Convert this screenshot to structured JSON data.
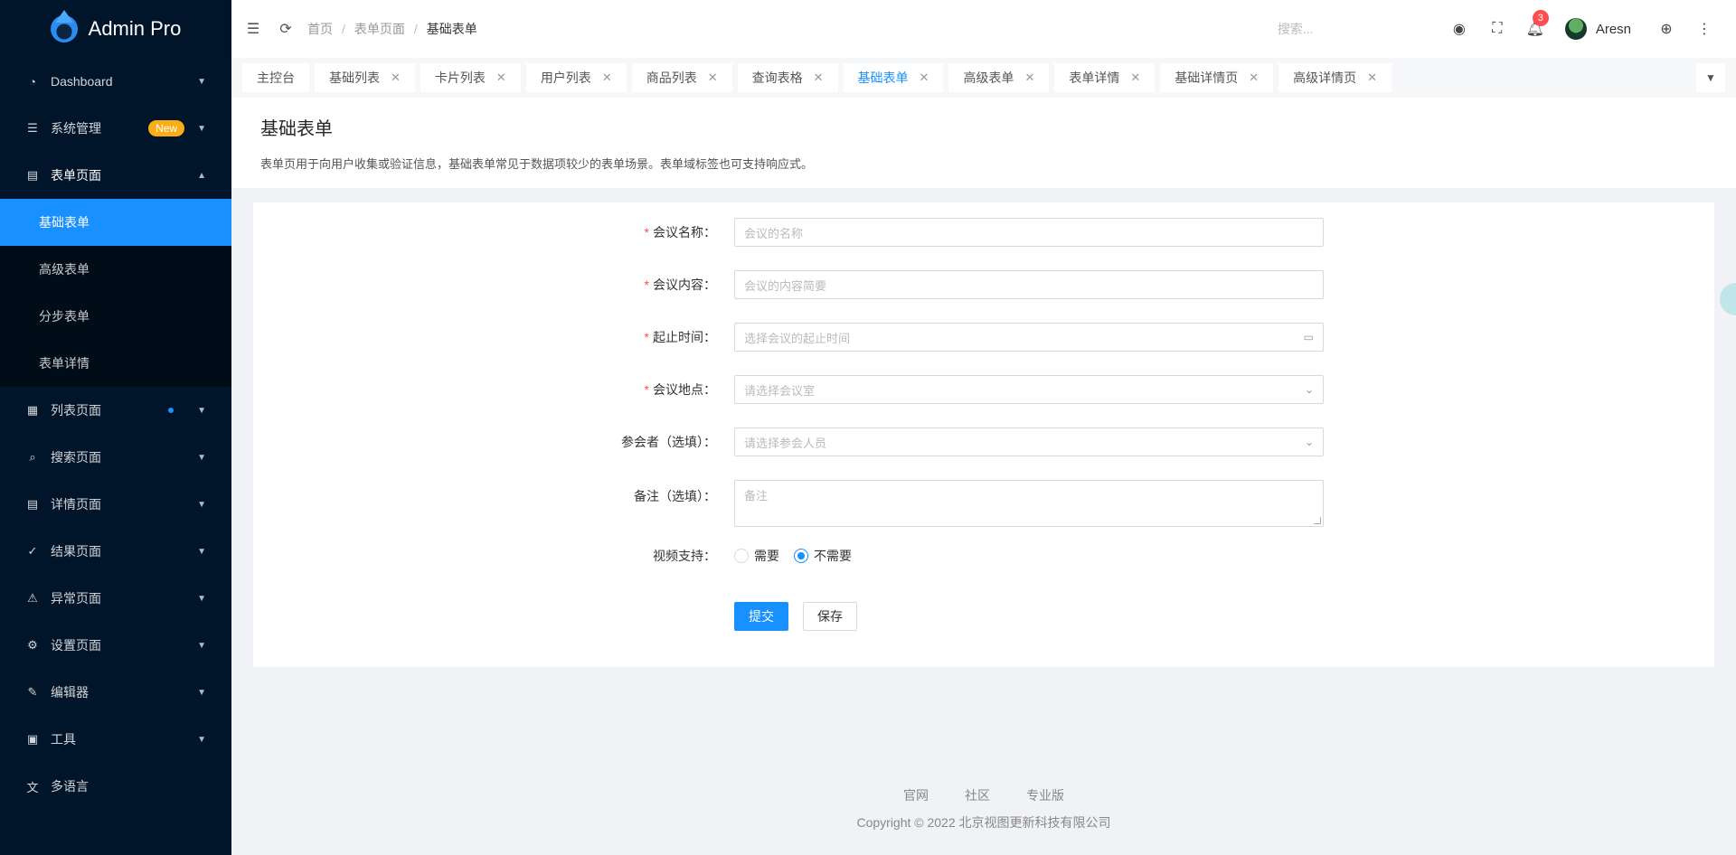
{
  "app": {
    "title": "Admin Pro"
  },
  "sidebar": {
    "items": [
      {
        "label": "Dashboard",
        "icon": "dashboard-icon"
      },
      {
        "label": "系统管理",
        "icon": "settings-sliders-icon",
        "badge": "New"
      },
      {
        "label": "表单页面",
        "icon": "form-icon",
        "open": true,
        "children": [
          "基础表单",
          "高级表单",
          "分步表单",
          "表单详情"
        ]
      },
      {
        "label": "列表页面",
        "icon": "table-icon"
      },
      {
        "label": "搜索页面",
        "icon": "search-icon"
      },
      {
        "label": "详情页面",
        "icon": "profile-icon"
      },
      {
        "label": "结果页面",
        "icon": "check-circle-icon"
      },
      {
        "label": "异常页面",
        "icon": "warning-icon"
      },
      {
        "label": "设置页面",
        "icon": "control-icon"
      },
      {
        "label": "编辑器",
        "icon": "edit-icon"
      },
      {
        "label": "工具",
        "icon": "tool-icon"
      },
      {
        "label": "多语言",
        "icon": "translate-icon"
      }
    ]
  },
  "header": {
    "breadcrumb": [
      "首页",
      "表单页面",
      "基础表单"
    ],
    "search_placeholder": "搜索...",
    "notification_count": "3",
    "username": "Aresn"
  },
  "tabs": [
    "主控台",
    "基础列表",
    "卡片列表",
    "用户列表",
    "商品列表",
    "查询表格",
    "基础表单",
    "高级表单",
    "表单详情",
    "基础详情页",
    "高级详情页"
  ],
  "page": {
    "title": "基础表单",
    "description": "表单页用于向用户收集或验证信息，基础表单常见于数据项较少的表单场景。表单域标签也可支持响应式。"
  },
  "form": {
    "name": {
      "label": "会议名称：",
      "placeholder": "会议的名称"
    },
    "content": {
      "label": "会议内容：",
      "placeholder": "会议的内容简要"
    },
    "time": {
      "label": "起止时间：",
      "placeholder": "选择会议的起止时间"
    },
    "place": {
      "label": "会议地点：",
      "placeholder": "请选择会议室"
    },
    "attendees": {
      "label": "参会者（选填）：",
      "placeholder": "请选择参会人员"
    },
    "remark": {
      "label": "备注（选填）：",
      "placeholder": "备注"
    },
    "video": {
      "label": "视频支持：",
      "options": [
        "需要",
        "不需要"
      ],
      "selected": "不需要"
    },
    "submit_label": "提交",
    "save_label": "保存"
  },
  "footer": {
    "links": [
      "官网",
      "社区",
      "专业版"
    ],
    "copyright": "Copyright © 2022 北京视图更新科技有限公司"
  },
  "colors": {
    "primary": "#1890ff",
    "sidebar": "#001529",
    "badge": "#faad14",
    "danger": "#ff4d4f"
  }
}
